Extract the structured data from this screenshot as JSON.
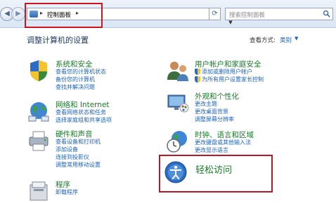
{
  "address_bar": {
    "breadcrumb": "控制面板",
    "search_placeholder": "搜索控制面板"
  },
  "header": {
    "title": "调整计算机的设置",
    "view_by_label": "查看方式:",
    "view_by_value": "类别"
  },
  "categories": [
    {
      "title": "系统和安全",
      "links": [
        "查看您的计算机状态",
        "备份您的计算机",
        "查找并解决问题"
      ]
    },
    {
      "title": "网络和 Internet",
      "links": [
        "查看网络状态和任务",
        "选择家庭组和共享选项"
      ]
    },
    {
      "title": "硬件和声音",
      "links": [
        "查看设备和打印机",
        "添加设备",
        "连接到投影仪",
        "调整常用移动设置"
      ]
    },
    {
      "title": "程序",
      "links": [
        "卸载程序"
      ]
    },
    {
      "title": "用户帐户和家庭安全",
      "links": [
        "添加或删除用户帐户",
        "为所有用户设置家长控制"
      ]
    },
    {
      "title": "外观和个性化",
      "links": [
        "更改主题",
        "更改桌面背景",
        "调整屏幕分辨率"
      ]
    },
    {
      "title": "时钟、语言和区域",
      "links": [
        "更改键盘或其他输入法",
        "更改显示语言"
      ]
    },
    {
      "title": "轻松访问",
      "links": []
    }
  ],
  "colors": {
    "highlight_box": "#d0141e",
    "category_title": "#1a7a2a",
    "link": "#1e62b6"
  }
}
